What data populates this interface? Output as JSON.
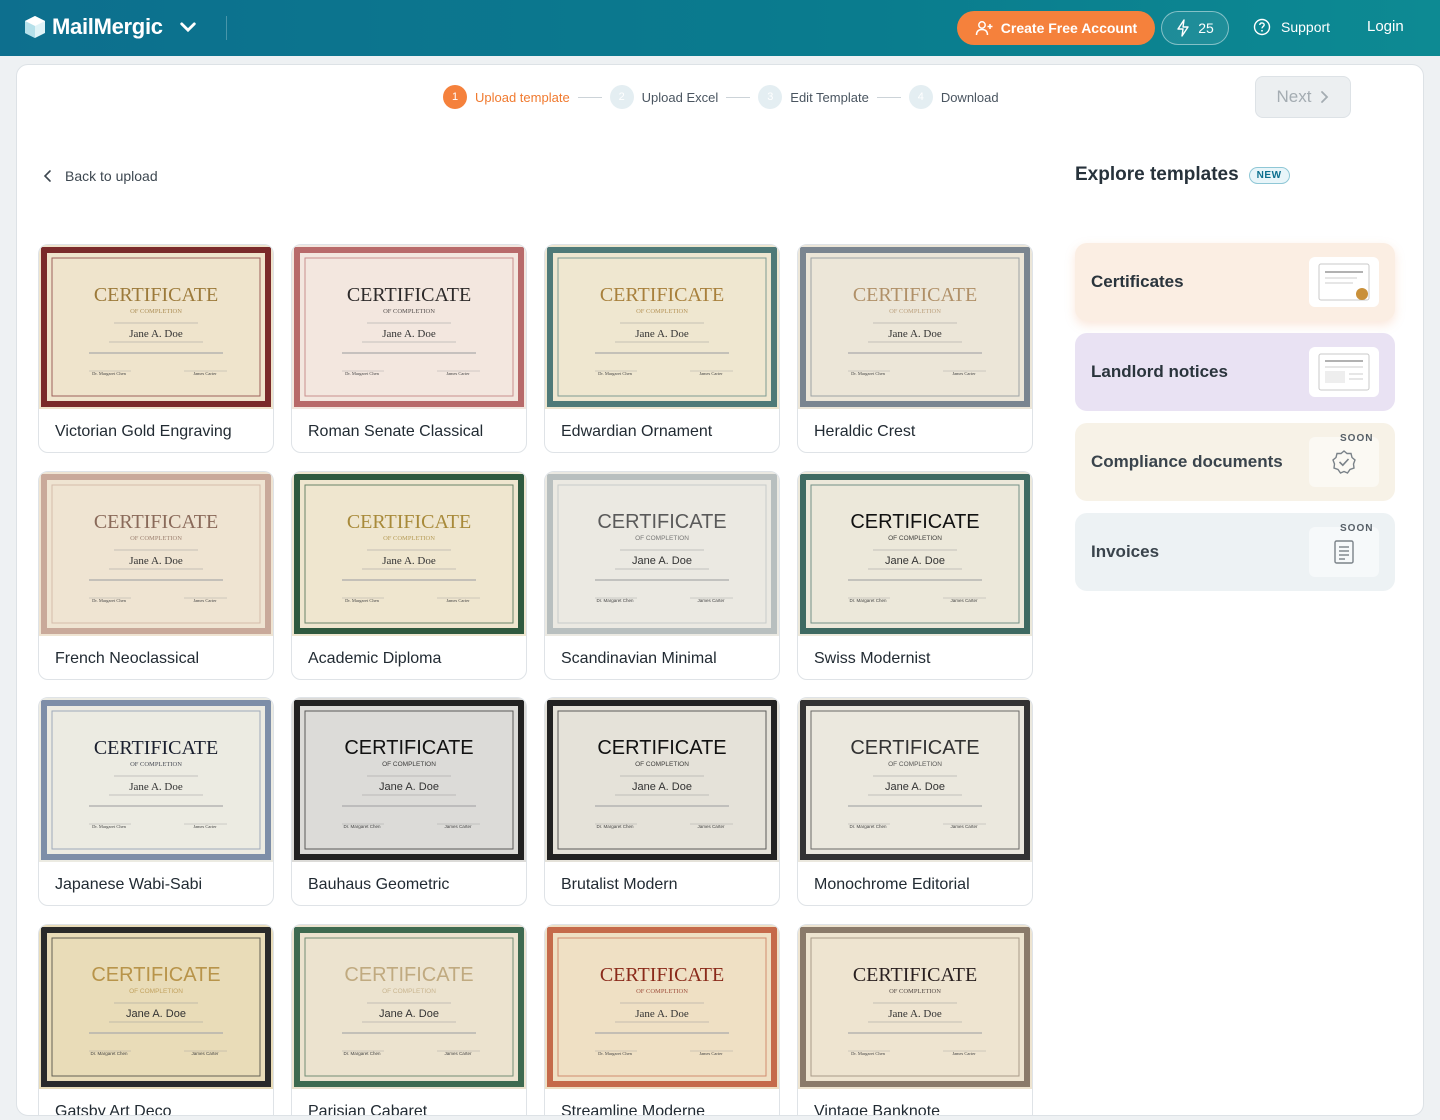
{
  "header": {
    "brand": "MailMergic",
    "create_account": "Create Free Account",
    "credits": "25",
    "support": "Support",
    "login": "Login"
  },
  "stepper": {
    "steps": [
      {
        "num": "1",
        "label": "Upload template",
        "active": true
      },
      {
        "num": "2",
        "label": "Upload Excel",
        "active": false
      },
      {
        "num": "3",
        "label": "Edit Template",
        "active": false
      },
      {
        "num": "4",
        "label": "Download",
        "active": false
      }
    ],
    "next": "Next"
  },
  "back": "Back to upload",
  "templates": [
    {
      "name": "Victorian Gold Engraving",
      "bg": "#efe4cc",
      "frame": "#7a2a2a",
      "heading": "#9c7a3a",
      "serif": true
    },
    {
      "name": "Roman Senate Classical",
      "bg": "#f3e7df",
      "frame": "#b86a6a",
      "heading": "#2d2a2a",
      "serif": true
    },
    {
      "name": "Edwardian Ornament",
      "bg": "#efe7d0",
      "frame": "#4f7a78",
      "heading": "#a8803c",
      "serif": true
    },
    {
      "name": "Heraldic Crest",
      "bg": "#ece6d8",
      "frame": "#7a8590",
      "heading": "#b09068",
      "serif": true
    },
    {
      "name": "French Neoclassical",
      "bg": "#efe4d2",
      "frame": "#c9a99a",
      "heading": "#8a6a5a",
      "serif": true
    },
    {
      "name": "Academic Diploma",
      "bg": "#efe6cf",
      "frame": "#2f5a3f",
      "heading": "#a88a3a",
      "serif": true
    },
    {
      "name": "Scandinavian Minimal",
      "bg": "#ebe9e2",
      "frame": "#b8bfbf",
      "heading": "#5a5a5a",
      "serif": false
    },
    {
      "name": "Swiss Modernist",
      "bg": "#ece8da",
      "frame": "#3e6a62",
      "heading": "#111111",
      "serif": false
    },
    {
      "name": "Japanese Wabi-Sabi",
      "bg": "#ecebe2",
      "frame": "#7d8ea8",
      "heading": "#1a1f2e",
      "serif": true
    },
    {
      "name": "Bauhaus Geometric",
      "bg": "#dcdbd8",
      "frame": "#222222",
      "heading": "#111111",
      "serif": false
    },
    {
      "name": "Brutalist Modern",
      "bg": "#e5e2d9",
      "frame": "#222222",
      "heading": "#111111",
      "serif": false
    },
    {
      "name": "Monochrome Editorial",
      "bg": "#ebe8de",
      "frame": "#333333",
      "heading": "#333333",
      "serif": false
    },
    {
      "name": "Gatsby Art Deco",
      "bg": "#e9dcb8",
      "frame": "#2a2a2a",
      "heading": "#b8944a",
      "serif": false
    },
    {
      "name": "Parisian Cabaret",
      "bg": "#ece3cf",
      "frame": "#3e6a50",
      "heading": "#c0aa80",
      "serif": false
    },
    {
      "name": "Streamline Moderne",
      "bg": "#efe0c4",
      "frame": "#c56a4a",
      "heading": "#8a2a1a",
      "serif": true
    },
    {
      "name": "Vintage Banknote",
      "bg": "#eee4d0",
      "frame": "#8a7a6a",
      "heading": "#2a2020",
      "serif": true
    }
  ],
  "cert_text": {
    "heading": "CERTIFICATE",
    "sub": "OF COMPLETION",
    "recipient": "Jane A. Doe",
    "signer_left": "Dr. Margaret Chen",
    "signer_right": "James Carter"
  },
  "explore": {
    "title": "Explore templates",
    "badge": "NEW",
    "categories": [
      {
        "label": "Certificates",
        "bg": "#fbeee3",
        "soon": ""
      },
      {
        "label": "Landlord notices",
        "bg": "#e9e2f3",
        "soon": ""
      },
      {
        "label": "Compliance documents",
        "bg": "#f7f2e7",
        "soon": "SOON"
      },
      {
        "label": "Invoices",
        "bg": "#edf2f4",
        "soon": "SOON"
      }
    ]
  }
}
